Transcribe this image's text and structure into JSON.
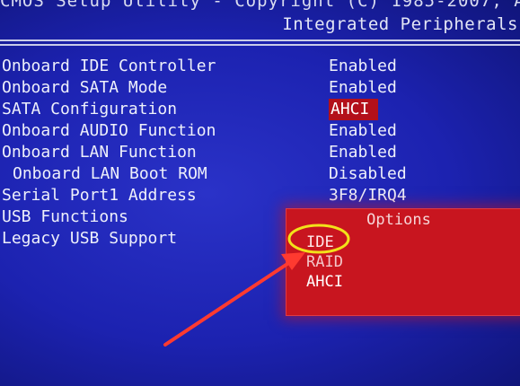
{
  "header": {
    "title_line": "CMOS Setup Utility - Copyright (C) 1985-2007, A",
    "subtitle": "Integrated Peripherals"
  },
  "settings": [
    {
      "label": "Onboard IDE Controller",
      "value": "Enabled"
    },
    {
      "label": "Onboard SATA Mode",
      "value": "Enabled"
    },
    {
      "label": "SATA Configuration",
      "value": "AHCI",
      "highlighted": true
    },
    {
      "label": "Onboard AUDIO Function",
      "value": "Enabled"
    },
    {
      "label": "Onboard LAN Function",
      "value": "Enabled"
    },
    {
      "label": "Onboard LAN Boot ROM",
      "value": "Disabled"
    },
    {
      "label": "Serial Port1 Address",
      "value": "3F8/IRQ4"
    },
    {
      "label": "USB Functions",
      "value": ""
    },
    {
      "label": "Legacy USB Support",
      "value": ""
    }
  ],
  "options_popup": {
    "title": "Options",
    "items": [
      "IDE",
      "RAID",
      "AHCI"
    ],
    "circled_item": "IDE"
  },
  "colors": {
    "background": "#1c22b0",
    "text": "#eef0fb",
    "popup": "#c8151f",
    "highlight": "#b3101a",
    "annotation_circle": "#f2e21a",
    "annotation_arrow": "#ff3a30"
  }
}
